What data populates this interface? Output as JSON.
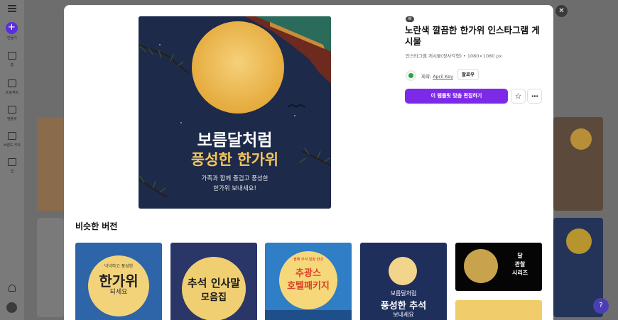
{
  "rail": {
    "create_label": "만들기",
    "items": [
      "홈",
      "프로젝트",
      "템플릿",
      "브랜드 키트",
      "앱"
    ]
  },
  "modal": {
    "badge": "W",
    "title": "노란색 깔끔한 한가위 인스타그램 게시물",
    "meta": "인스타그램 게시물(정사각형) • 1080×1080 px",
    "creator_prefix": "제작:",
    "creator_name": "April Key",
    "follow_label": "팔로우",
    "cta_label": "이 템플릿 맞춤 편집하기",
    "close_icon": "close-icon",
    "star_icon": "star-icon",
    "more_icon": "more-icon"
  },
  "poster": {
    "headline_1": "보름달처럼",
    "headline_2": "풍성한 한가위",
    "body_1": "가족과 함께 즐겁고 풍성한",
    "body_2": "한가위 보내세요!"
  },
  "similar": {
    "heading": "비슷한 버전",
    "items": [
      {
        "line1": "넉넉하고 풍성한",
        "line2": "한가위",
        "line3": "되세요"
      },
      {
        "line1": "추석 인사말",
        "line2": "모음집"
      },
      {
        "line1": "올해 추석 일정 안내",
        "line2": "추광스",
        "line3": "호텔패키지"
      },
      {
        "line1": "보름달처럼",
        "line2": "풍성한 추석",
        "line3": "보내세요"
      },
      {
        "line1": "달",
        "line2": "관찰",
        "line3": "시리즈"
      }
    ]
  },
  "colors": {
    "accent": "#7d2ae8",
    "overlay": "#6d6d6d",
    "moon": "#e8b547",
    "night": "#1d2a4a"
  },
  "help_label": "?"
}
